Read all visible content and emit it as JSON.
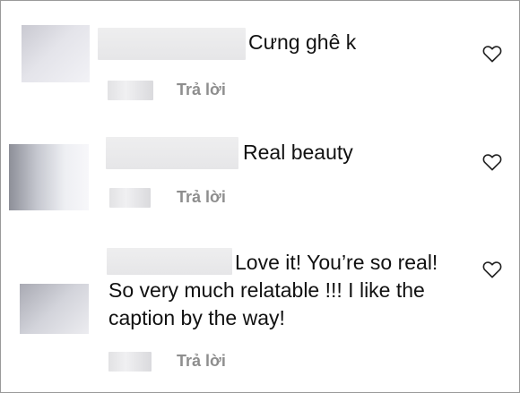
{
  "comments": [
    {
      "text": "Cưng ghê k",
      "reply_label": "Trả lời",
      "like_icon": "heart-icon"
    },
    {
      "text": "Real beauty",
      "reply_label": "Trả lời",
      "like_icon": "heart-icon"
    },
    {
      "text_lines": [
        "Love it! You’re so real!",
        "So very much relatable !!! I like the",
        "caption by the way!"
      ],
      "reply_label": "Trả lời",
      "like_icon": "heart-icon"
    }
  ]
}
